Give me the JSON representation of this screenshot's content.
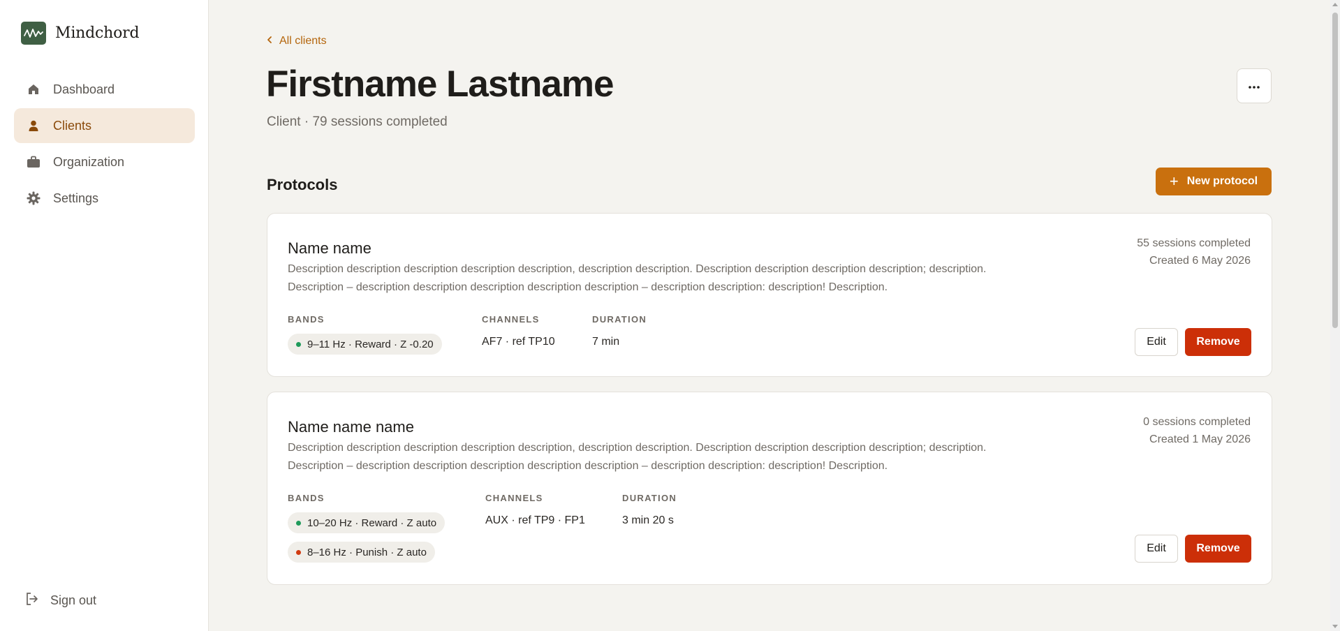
{
  "app": {
    "name": "Mindchord"
  },
  "sidebar": {
    "items": [
      {
        "label": "Dashboard",
        "icon": "home-icon",
        "active": false
      },
      {
        "label": "Clients",
        "icon": "person-icon",
        "active": true
      },
      {
        "label": "Organization",
        "icon": "briefcase-icon",
        "active": false
      },
      {
        "label": "Settings",
        "icon": "gear-icon",
        "active": false
      }
    ],
    "signout": {
      "label": "Sign out",
      "icon": "sign-out-icon"
    }
  },
  "header": {
    "back_label": "All clients",
    "title": "Firstname Lastname",
    "subtitle": "Client · 79 sessions completed",
    "more_icon": "more-horizontal-icon"
  },
  "protocols": {
    "section_title": "Protocols",
    "new_button_label": "New protocol",
    "field_labels": {
      "bands": "BANDS",
      "channels": "CHANNELS",
      "duration": "DURATION"
    },
    "items": [
      {
        "name": "Name name",
        "description_1": "Description description description description description, description description. Description description description description; description.",
        "description_2": "Description – description description description description description – description description: description! Description.",
        "sessions": "55 sessions completed",
        "created": "Created 6 May 2026",
        "bands": [
          {
            "label": "9–11 Hz · Reward · Z -0.20",
            "color": "#1f9a5b"
          }
        ],
        "channels": "AF7 · ref TP10",
        "duration": "7 min",
        "edit_label": "Edit",
        "remove_label": "Remove"
      },
      {
        "name": "Name name name",
        "description_1": "Description description description description description, description description. Description description description description; description.",
        "description_2": "Description – description description description description description – description description: description! Description.",
        "sessions": "0 sessions completed",
        "created": "Created 1 May 2026",
        "bands": [
          {
            "label": "10–20 Hz · Reward · Z auto",
            "color": "#1f9a5b"
          },
          {
            "label": "8–16 Hz · Punish · Z auto",
            "color": "#d03a10"
          }
        ],
        "channels": "AUX · ref TP9 · FP1",
        "duration": "3 min 20 s",
        "edit_label": "Edit",
        "remove_label": "Remove"
      }
    ]
  },
  "colors": {
    "accent": "#c9700e",
    "danger": "#cc2f08",
    "brand": "#3f5f44",
    "active_nav_bg": "#f5e9dc"
  }
}
